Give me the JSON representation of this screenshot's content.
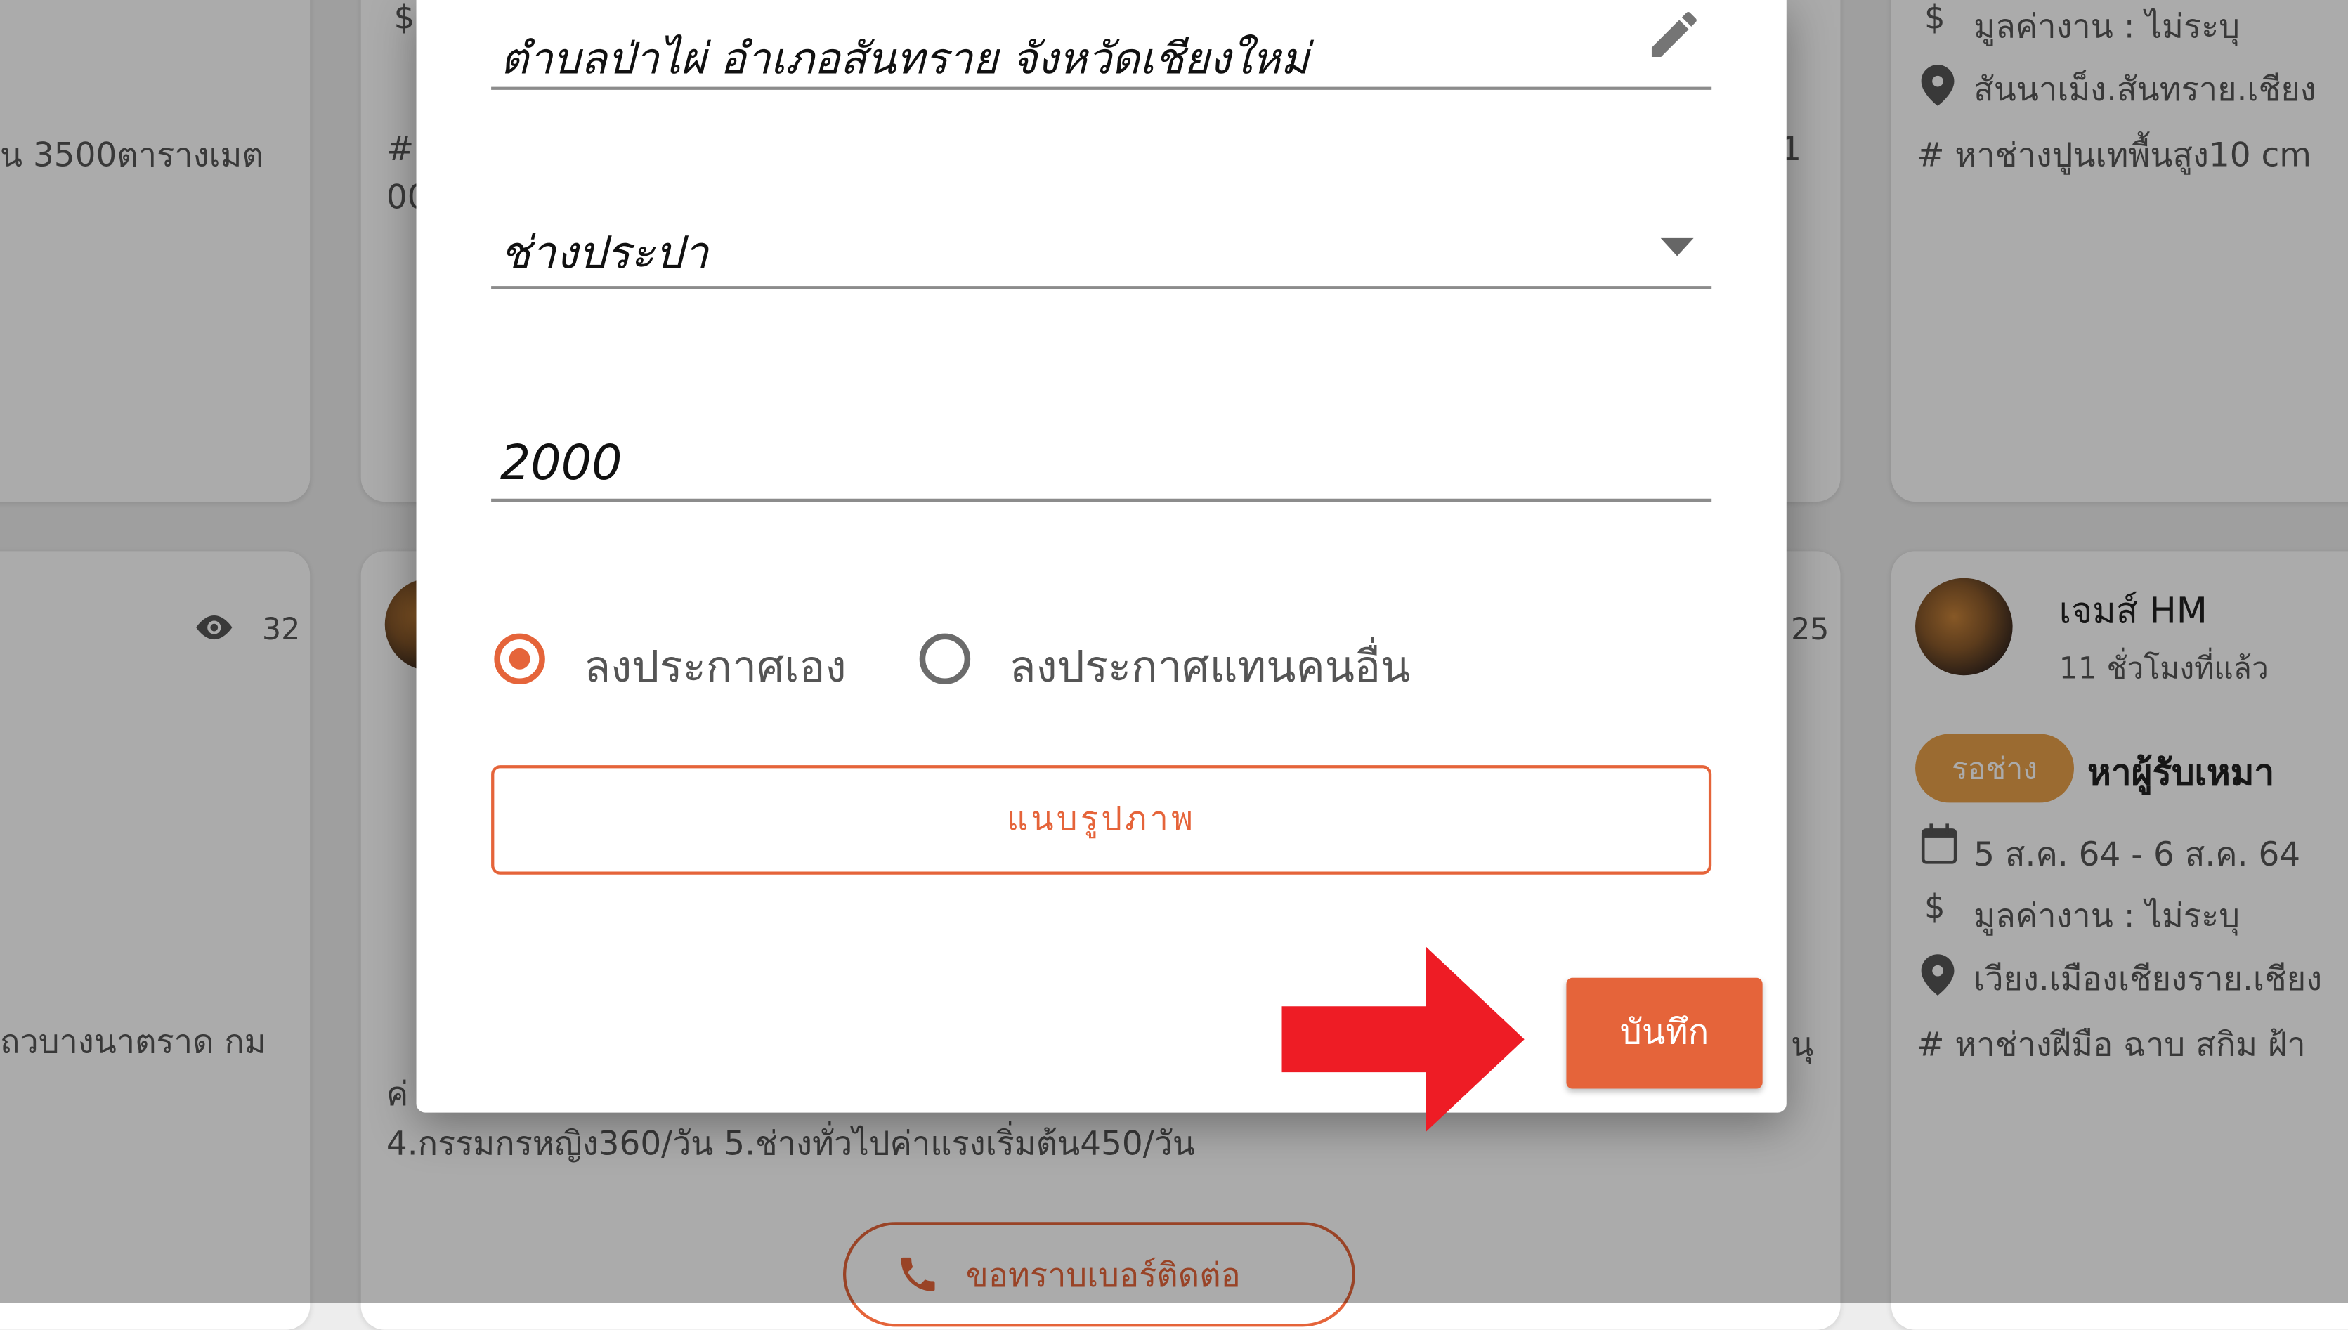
{
  "modal": {
    "address_value": "ตำบลป่าไผ่ อำเภอสันทราย จังหวัดเชียงใหม่",
    "job_type_value": "ช่างประปา",
    "price_value": "2000",
    "radio_options": [
      {
        "label": "ลงประกาศเอง",
        "selected": true
      },
      {
        "label": "ลงประกาศแทนคนอื่น",
        "selected": false
      }
    ],
    "attach_label": "แนบรูปภาพ",
    "save_label": "บันทึก"
  },
  "background": {
    "left_card_top_text": "น 3500ตารางเมต",
    "left_card_bottom_text": "ถวบางนาตราด กม",
    "left_view_count": "32",
    "mid_card_hash_fragment": "#",
    "mid_card_00": "00",
    "mid_card_bottom_line": "4.กรรมกรหญิง360/วัน 5.ช่างทั่วไปค่าแรงเริ่มต้น450/วัน",
    "mid_card_ka": "ค่",
    "contact_button_label": "ขอทราบเบอร์ติดต่อ",
    "mid_right_count": "25",
    "mid_right_1": "1",
    "mid_right_nu": "นุ",
    "right_card_top": {
      "price": "มูลค่างาน : ไม่ระบุ",
      "location": "สันนาเม็ง.สันทราย.เชียง",
      "tag": "# หาช่างปูนเทพื้นสูง10 cm"
    },
    "right_card_bottom": {
      "user_name": "เจมส์ HM",
      "time_ago": "11 ชั่วโมงที่แล้ว",
      "status_pill": "รอช่าง",
      "title": "หาผู้รับเหมา",
      "dates": "5 ส.ค. 64 - 6 ส.ค. 64",
      "price": "มูลค่างาน : ไม่ระบุ",
      "location": "เวียง.เมืองเชียงราย.เชียง",
      "tag": "# หาช่างฝีมือ ฉาบ สกิม ฝ้า"
    }
  },
  "colors": {
    "accent": "#e5643a",
    "pill": "#e8a04a",
    "arrow": "#ee1c25"
  }
}
